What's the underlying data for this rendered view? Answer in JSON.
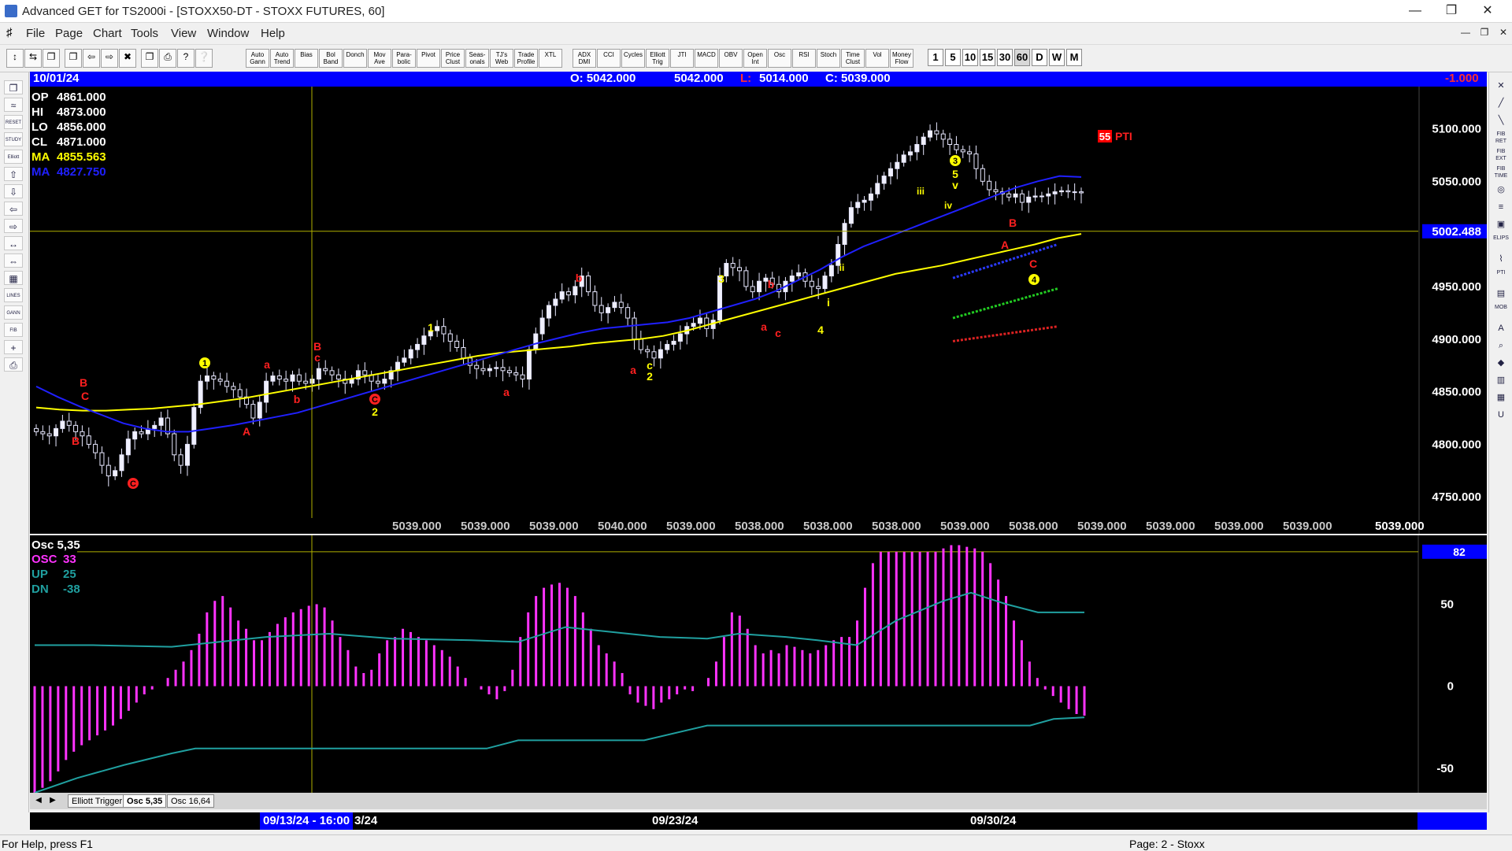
{
  "window": {
    "title": "Advanced GET for TS2000i - [STOXX50-DT - STOXX FUTURES, 60]",
    "min_label": "—",
    "max_label": "❐",
    "close_label": "✕"
  },
  "menu": [
    "File",
    "Page",
    "Chart",
    "Tools",
    "View",
    "Window",
    "Help"
  ],
  "toolbar": {
    "study_buttons": [
      "Auto Gann",
      "Auto Trend",
      "Bias",
      "Bol Band",
      "Donch",
      "Mov Ave",
      "Para- bolic",
      "Pivot",
      "Price Clust",
      "Seas- onals",
      "TJ's Web",
      "Trade Profile",
      "XTL",
      "ADX DMI",
      "CCI",
      "Cycles",
      "Elliott Trig",
      "JTI",
      "MACD",
      "OBV",
      "Open Int",
      "Osc",
      "RSI",
      "Stoch",
      "Time Clust",
      "Vol",
      "Money Flow"
    ],
    "timeframes": [
      "1",
      "5",
      "10",
      "15",
      "30",
      "60",
      "D",
      "W",
      "M"
    ]
  },
  "left_tools": [
    "❐",
    "≈",
    "RESET",
    "STUDY",
    "Elliott",
    "⇧",
    "⇩",
    "⇦",
    "⇨",
    "↔",
    "⇔",
    "▦",
    "LINES",
    "GANN",
    "FIB",
    "+",
    "⎙"
  ],
  "right_tools": [
    "✕",
    "╱",
    "╲",
    "FIB RET",
    "FIB EXT",
    "FIB TIME",
    "◎",
    "≡",
    "▣",
    "ELIPS",
    "⌇",
    "PTI",
    "▤",
    "MOB",
    "A",
    "⌕",
    "◆",
    "▥",
    "▦",
    "U"
  ],
  "header": {
    "date": "10/01/24",
    "open": "O: 5042.000",
    "high": "5042.000",
    "low_label": "L:",
    "low": "5014.000",
    "close": "C: 5039.000",
    "change": "-1.000"
  },
  "price_info": [
    {
      "label": "OP",
      "value": "4861.000",
      "color": "#ffffff"
    },
    {
      "label": "HI",
      "value": "4873.000",
      "color": "#ffffff"
    },
    {
      "label": "LO",
      "value": "4856.000",
      "color": "#ffffff"
    },
    {
      "label": "CL",
      "value": "4871.000",
      "color": "#ffffff"
    },
    {
      "label": "MA",
      "value": "4855.563",
      "color": "#ffff00"
    },
    {
      "label": "MA",
      "value": "4827.750",
      "color": "#2020ff"
    }
  ],
  "price_axis": [
    "5100.000",
    "5050.000",
    "5002.488",
    "4950.000",
    "4900.000",
    "4850.000",
    "4800.000",
    "4750.000"
  ],
  "crosshair_price": "5002.488",
  "close_values_row": [
    "5039.000",
    "5039.000",
    "5039.000",
    "5040.000",
    "5039.000",
    "5038.000",
    "5038.000",
    "5038.000",
    "5039.000",
    "5038.000",
    "5039.000",
    "5039.000",
    "5039.000",
    "5039.000",
    "5039.000"
  ],
  "pti": {
    "value": "55",
    "label": "PTI"
  },
  "osc": {
    "title": "Osc 5,35",
    "lines": [
      {
        "label": "OSC",
        "value": "33",
        "color": "#ff33ff"
      },
      {
        "label": "UP",
        "value": "25",
        "color": "#20a0a0"
      },
      {
        "label": "DN",
        "value": "-38",
        "color": "#20a0a0"
      }
    ],
    "axis": [
      "82",
      "50",
      "0",
      "-50"
    ],
    "level_badge": "82"
  },
  "tabs": [
    "Elliott Trigger",
    "Osc 5,35",
    "Osc 16,64"
  ],
  "dates": {
    "crosshair": "09/13/24 - 16:00",
    "tail": "3/24",
    "d2": "09/23/24",
    "d3": "09/30/24"
  },
  "status": {
    "help": "For Help, press F1",
    "page": "Page: 2 - Stoxx"
  },
  "chart_data": [
    {
      "type": "candlestick",
      "title": "STOXX50-DT - STOXX FUTURES, 60",
      "ylim": [
        4715,
        5140
      ],
      "price_axis_ticks": [
        4750,
        4800,
        4850,
        4900,
        4950,
        5000,
        5050,
        5100
      ],
      "closes": [
        4812,
        4810,
        4808,
        4815,
        4822,
        4818,
        4812,
        4808,
        4800,
        4792,
        4780,
        4770,
        4775,
        4790,
        4805,
        4812,
        4810,
        4815,
        4818,
        4825,
        4810,
        4790,
        4780,
        4800,
        4835,
        4860,
        4865,
        4862,
        4860,
        4855,
        4852,
        4845,
        4838,
        4825,
        4840,
        4860,
        4865,
        4862,
        4860,
        4866,
        4860,
        4858,
        4862,
        4872,
        4870,
        4866,
        4862,
        4858,
        4862,
        4870,
        4866,
        4860,
        4858,
        4862,
        4870,
        4878,
        4882,
        4890,
        4895,
        4903,
        4908,
        4912,
        4905,
        4898,
        4892,
        4882,
        4875,
        4872,
        4870,
        4872,
        4873,
        4870,
        4868,
        4866,
        4862,
        4890,
        4905,
        4920,
        4932,
        4938,
        4945,
        4942,
        4950,
        4960,
        4945,
        4932,
        4925,
        4930,
        4935,
        4930,
        4920,
        4900,
        4890,
        4888,
        4882,
        4890,
        4895,
        4898,
        4905,
        4912,
        4915,
        4920,
        4910,
        4918,
        4960,
        4972,
        4968,
        4965,
        4950,
        4945,
        4955,
        4958,
        4952,
        4945,
        4955,
        4960,
        4963,
        4955,
        4950,
        4948,
        4960,
        4970,
        4990,
        5010,
        5025,
        5030,
        5032,
        5038,
        5048,
        5055,
        5062,
        5068,
        5075,
        5078,
        5085,
        5092,
        5098,
        5095,
        5090,
        5085,
        5080,
        5078,
        5076,
        5062,
        5050,
        5042,
        5040,
        5038,
        5035,
        5038,
        5030,
        5035,
        5036,
        5036,
        5038,
        5040,
        5041,
        5040,
        5040,
        5039
      ],
      "series": [
        {
          "name": "MA",
          "value": 4855.563,
          "color": "#ffff00",
          "values": [
            4835,
            4833,
            4832,
            4832,
            4833,
            4834,
            4836,
            4838,
            4841,
            4844,
            4848,
            4852,
            4856,
            4860,
            4864,
            4868,
            4872,
            4876,
            4880,
            4884,
            4887,
            4889,
            4891,
            4893,
            4896,
            4898,
            4900,
            4903,
            4908,
            4914,
            4920,
            4926,
            4932,
            4938,
            4944,
            4950,
            4956,
            4962,
            4966,
            4970,
            4975,
            4980,
            4985,
            4990,
            4996,
            5000
          ]
        },
        {
          "name": "MA",
          "value": 4827.75,
          "color": "#2020ff",
          "values": [
            4855,
            4845,
            4836,
            4828,
            4820,
            4815,
            4812,
            4812,
            4815,
            4818,
            4822,
            4826,
            4830,
            4836,
            4842,
            4848,
            4854,
            4860,
            4866,
            4872,
            4878,
            4884,
            4890,
            4896,
            4901,
            4906,
            4910,
            4912,
            4914,
            4916,
            4920,
            4926,
            4932,
            4938,
            4946,
            4956,
            4966,
            4978,
            4988,
            4996,
            5004,
            5012,
            5020,
            5028,
            5036,
            5044,
            5050,
            5055,
            5054
          ]
        }
      ],
      "wave_labels": [
        "B",
        "C",
        "B",
        "C",
        "1",
        "A",
        "a",
        "b",
        "B",
        "c",
        "2",
        "C",
        "1",
        "a",
        "b",
        "a",
        "3",
        "b",
        "a",
        "c",
        "i",
        "4",
        "2",
        "c",
        "iii",
        "iv",
        "3",
        "5",
        "v",
        "ii",
        "B",
        "A",
        "C",
        "4"
      ]
    },
    {
      "type": "bar",
      "title": "Osc 5,35",
      "ylim": [
        -65,
        92
      ],
      "axis_ticks": [
        -50,
        0,
        50,
        82
      ],
      "reference_level": 82,
      "values": [
        -65,
        -62,
        -58,
        -52,
        -45,
        -40,
        -36,
        -33,
        -30,
        -27,
        -24,
        -20,
        -15,
        -10,
        -5,
        -2,
        0,
        5,
        10,
        15,
        22,
        32,
        45,
        52,
        55,
        48,
        40,
        35,
        28,
        28,
        33,
        38,
        42,
        45,
        47,
        49,
        50,
        48,
        40,
        30,
        22,
        12,
        8,
        10,
        20,
        28,
        30,
        35,
        33,
        30,
        28,
        25,
        22,
        18,
        12,
        5,
        0,
        -2,
        -5,
        -8,
        -3,
        10,
        30,
        45,
        55,
        60,
        62,
        63,
        60,
        55,
        45,
        35,
        25,
        20,
        15,
        8,
        -5,
        -10,
        -12,
        -14,
        -10,
        -8,
        -5,
        -2,
        -3,
        0,
        5,
        15,
        30,
        45,
        43,
        35,
        25,
        20,
        22,
        20,
        25,
        24,
        22,
        20,
        22,
        25,
        28,
        30,
        30,
        40,
        60,
        75,
        82,
        82,
        82,
        82,
        82,
        82,
        82,
        82,
        84,
        86,
        86,
        85,
        84,
        82,
        75,
        65,
        55,
        40,
        28,
        15,
        5,
        -2,
        -6,
        -10,
        -14,
        -17,
        -18
      ]
    }
  ]
}
